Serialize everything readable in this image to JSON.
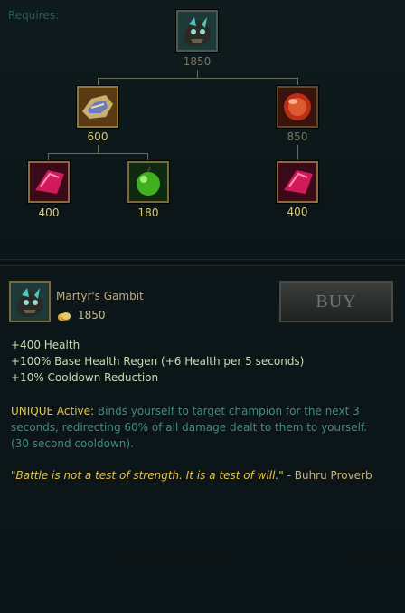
{
  "tree": {
    "requires_label": "Requires:",
    "root": {
      "icon": "martyrs-gambit-icon",
      "cost": "1850"
    },
    "left": {
      "icon": "armored-gauntlet-icon",
      "cost": "600"
    },
    "right": {
      "icon": "red-orb-icon",
      "cost": "850"
    },
    "leaf1": {
      "icon": "ruby-crystal-icon",
      "cost": "400"
    },
    "leaf2": {
      "icon": "green-apple-icon",
      "cost": "180"
    },
    "leaf3": {
      "icon": "ruby-crystal-icon",
      "cost": "400"
    }
  },
  "item": {
    "name": "Martyr's Gambit",
    "cost": "1850",
    "icon": "martyrs-gambit-icon",
    "buy_label": "BUY"
  },
  "stats": [
    "+400 Health",
    "+100% Base Health Regen (+6 Health per 5 seconds)",
    "+10% Cooldown Reduction"
  ],
  "active": {
    "label": "UNIQUE Active:",
    "text": " Binds yourself to target champion for the next 3 seconds, redirecting 60% of all damage dealt to them to  yourself. (30 second cooldown)."
  },
  "quote": {
    "text": "\"Battle is not a test of strength. It is a test of will.\"",
    "author": " - Buhru Proverb"
  },
  "colors": {
    "gold": "#d8c878",
    "active": "#e6c24a",
    "desc": "#3f8a86",
    "stat": "#c6dcb6"
  }
}
